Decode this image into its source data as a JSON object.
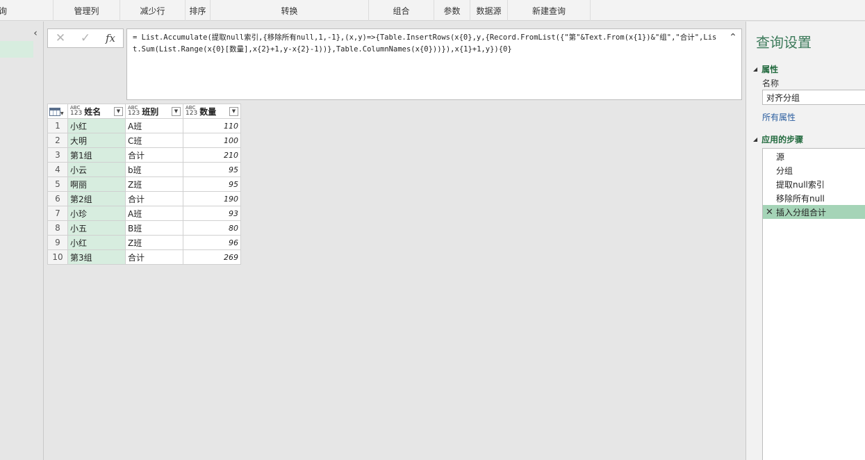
{
  "ribbon": {
    "groups": [
      "查询",
      "管理列",
      "减少行",
      "排序",
      "转换",
      "组合",
      "参数",
      "数据源",
      "新建查询"
    ]
  },
  "formula": {
    "cancel_icon": "✕",
    "commit_icon": "✓",
    "fx_label": "fx",
    "text": "= List.Accumulate(提取null索引,{移除所有null,1,-1},(x,y)=>{Table.InsertRows(x{0},y,{Record.FromList({\"第\"&Text.From(x{1})&\"组\",\"合计\",List.Sum(List.Range(x{0}[数量],x{2}+1,y-x{2}-1))},Table.ColumnNames(x{0}))}),x{1}+1,y}){0}"
  },
  "grid": {
    "columns": [
      {
        "type_top": "ABC",
        "type_bottom": "123",
        "name": "姓名"
      },
      {
        "type_top": "ABC",
        "type_bottom": "123",
        "name": "班别"
      },
      {
        "type_top": "ABC",
        "type_bottom": "123",
        "name": "数量"
      }
    ],
    "rows": [
      {
        "n": "1",
        "name": "小红",
        "cls": "A班",
        "qty": "110"
      },
      {
        "n": "2",
        "name": "大明",
        "cls": "C班",
        "qty": "100"
      },
      {
        "n": "3",
        "name": "第1组",
        "cls": "合计",
        "qty": "210"
      },
      {
        "n": "4",
        "name": "小云",
        "cls": "b班",
        "qty": "95"
      },
      {
        "n": "5",
        "name": "啊丽",
        "cls": "Z班",
        "qty": "95"
      },
      {
        "n": "6",
        "name": "第2组",
        "cls": "合计",
        "qty": "190"
      },
      {
        "n": "7",
        "name": "小珍",
        "cls": "A班",
        "qty": "93"
      },
      {
        "n": "8",
        "name": "小五",
        "cls": "B班",
        "qty": "80"
      },
      {
        "n": "9",
        "name": "小红",
        "cls": "Z班",
        "qty": "96"
      },
      {
        "n": "10",
        "name": "第3组",
        "cls": "合计",
        "qty": "269"
      }
    ]
  },
  "settings": {
    "title": "查询设置",
    "properties_label": "属性",
    "name_label": "名称",
    "name_value": "对齐分组",
    "all_properties": "所有属性",
    "steps_label": "应用的步骤",
    "steps": [
      "源",
      "分组",
      "提取null索引",
      "移除所有null",
      "插入分组合计"
    ],
    "active_step_index": 4
  },
  "colors": {
    "accent_green": "#3c7a5a",
    "selected_column": "#d7eddf",
    "active_step": "#a5d4b7"
  }
}
